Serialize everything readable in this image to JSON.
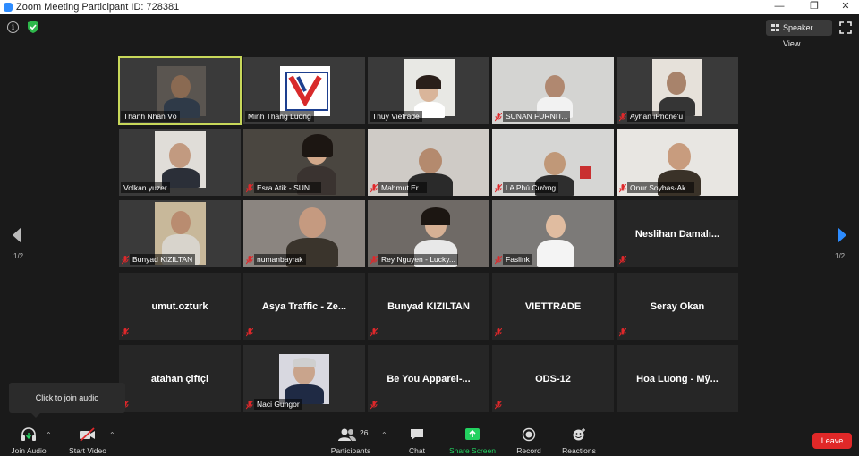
{
  "window": {
    "title": "Zoom Meeting Participant ID: 728381"
  },
  "header": {
    "speaker_view": "Speaker View"
  },
  "colors": {
    "active_outline": "#c8d85a",
    "leave": "#e02828",
    "share": "#23d160",
    "mute_red": "#e0282b"
  },
  "pagination": {
    "left": "1/2",
    "right": "1/2"
  },
  "participants": [
    {
      "name": "Thành Nhân Võ",
      "video": true,
      "muted": false,
      "active": true
    },
    {
      "name": "Minh Thang Luong",
      "video": true,
      "muted": false
    },
    {
      "name": "Thuy Vietrade",
      "video": true,
      "muted": false
    },
    {
      "name": "SUNAN FURNIT...",
      "video": true,
      "muted": true
    },
    {
      "name": "Ayhan iPhone'u",
      "video": true,
      "muted": true
    },
    {
      "name": "Volkan yuzer",
      "video": true,
      "muted": false
    },
    {
      "name": "Esra Atik - SUN ...",
      "video": true,
      "muted": true
    },
    {
      "name": "Mahmut Er...",
      "video": true,
      "muted": true
    },
    {
      "name": "Lê Phú Cường",
      "video": true,
      "muted": true
    },
    {
      "name": "Onur Soybas-Ak...",
      "video": true,
      "muted": true
    },
    {
      "name": "Bunyad KIZILTAN",
      "video": true,
      "muted": true
    },
    {
      "name": "numanbayrak",
      "video": true,
      "muted": true
    },
    {
      "name": "Rey Nguyen - Lucky...",
      "video": true,
      "muted": true
    },
    {
      "name": "Faslink",
      "video": true,
      "muted": true
    },
    {
      "name": "Neslihan Damalı...",
      "video": false,
      "muted": true
    },
    {
      "name": "umut.ozturk",
      "video": false,
      "muted": true
    },
    {
      "name": "Asya Traffic - Ze...",
      "video": false,
      "muted": true
    },
    {
      "name": "Bunyad KIZILTAN",
      "video": false,
      "muted": true
    },
    {
      "name": "VIETTRADE",
      "video": false,
      "muted": true
    },
    {
      "name": "Seray Okan",
      "video": false,
      "muted": true
    },
    {
      "name": "atahan çiftçi",
      "video": false,
      "muted": true
    },
    {
      "name": "Naci Gungor",
      "video": true,
      "muted": true
    },
    {
      "name": "Be You Apparel-...",
      "video": false,
      "muted": true
    },
    {
      "name": "ODS-12",
      "video": false,
      "muted": true
    },
    {
      "name": "Hoa Luong - Mỹ...",
      "video": false,
      "muted": false
    }
  ],
  "tooltip": {
    "text": "Click to join audio"
  },
  "toolbar": {
    "join_audio": "Join Audio",
    "start_video": "Start Video",
    "participants": "Participants",
    "participants_count": "26",
    "chat": "Chat",
    "share_screen": "Share Screen",
    "record": "Record",
    "reactions": "Reactions",
    "leave": "Leave"
  },
  "logo_text": "VIETTRADE"
}
